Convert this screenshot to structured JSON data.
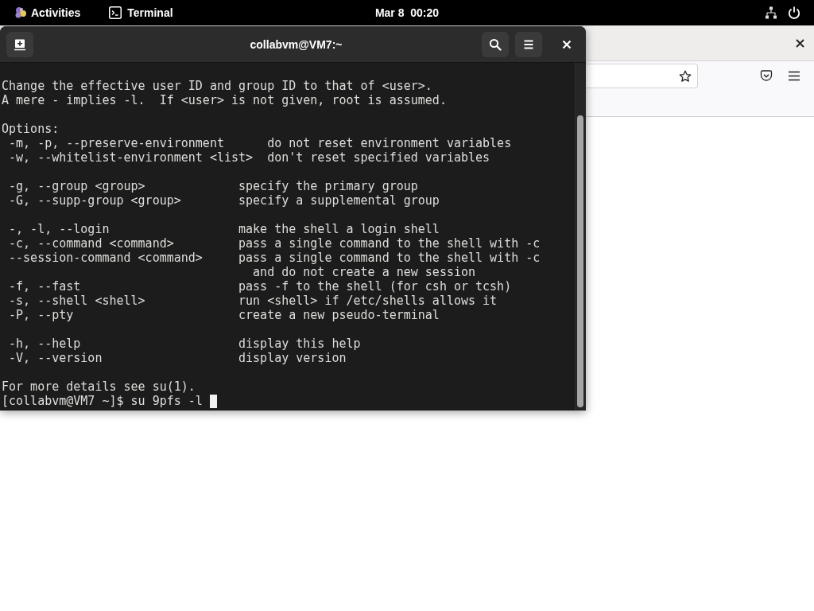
{
  "top_bar": {
    "activities": "Activities",
    "app_menu": "Terminal",
    "clock": "Mar 8  00:20"
  },
  "terminal": {
    "title": "collabvm@VM7:~",
    "output_blocks": [
      [
        "Change the effective user ID and group ID to that of <user>.",
        "A mere - implies -l.  If <user> is not given, root is assumed."
      ],
      [
        "Options:",
        " -m, -p, --preserve-environment      do not reset environment variables",
        " -w, --whitelist-environment <list>  don't reset specified variables"
      ],
      [
        " -g, --group <group>             specify the primary group",
        " -G, --supp-group <group>        specify a supplemental group"
      ],
      [
        " -, -l, --login                  make the shell a login shell",
        " -c, --command <command>         pass a single command to the shell with -c",
        " --session-command <command>     pass a single command to the shell with -c",
        "                                   and do not create a new session",
        " -f, --fast                      pass -f to the shell (for csh or tcsh)",
        " -s, --shell <shell>             run <shell> if /etc/shells allows it",
        " -P, --pty                       create a new pseudo-terminal"
      ],
      [
        " -h, --help                      display this help",
        " -V, --version                   display version"
      ],
      [
        "For more details see su(1)."
      ]
    ],
    "prompt_line": "[collabvm@VM7 ~]$ su 9pfs -l"
  }
}
